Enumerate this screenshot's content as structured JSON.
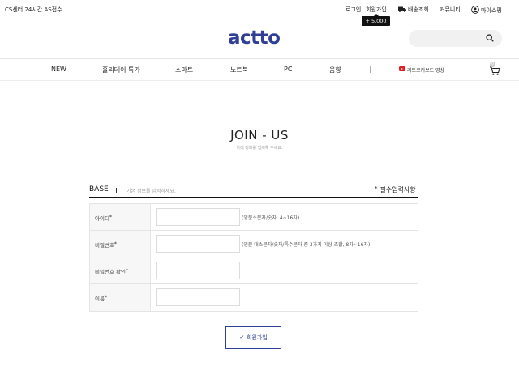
{
  "topbar": {
    "cs_text": "CS센터 24시간 AS접수",
    "login": "로그인",
    "join": "회원가입",
    "points_tip": "+ 5,000",
    "delivery": "배송조회",
    "community": "커뮤니티",
    "myshop": "마이쇼핑"
  },
  "logo": "actto",
  "search": {
    "placeholder": ""
  },
  "nav": {
    "items": [
      "NEW",
      "홀리데이 특가",
      "스마트",
      "노트북",
      "PC",
      "음향"
    ],
    "separator": "|",
    "youtube_label": "레트로키보드 영상",
    "cart_count": "0"
  },
  "page": {
    "title": "JOIN - US",
    "subtitle": "아래 정보를 입력해 주세요."
  },
  "section": {
    "label": "BASE",
    "desc": "기본 정보를 입력하세요.",
    "required_note": "필수입력사항",
    "required_mark": "*"
  },
  "form": {
    "rows": [
      {
        "label": "아이디",
        "value": "",
        "hint": "(영문소문자/숫자, 4~16자)"
      },
      {
        "label": "비밀번호",
        "value": "",
        "hint": "(영문 대소문자/숫자/특수문자 중 3가지 이상 조합, 8자~16자)"
      },
      {
        "label": "비밀번호 확인",
        "value": "",
        "hint": ""
      },
      {
        "label": "이름",
        "value": "",
        "hint": ""
      }
    ],
    "submit_label": "회원가입"
  },
  "colors": {
    "brand": "#2e3f94",
    "youtube": "#e02020"
  }
}
